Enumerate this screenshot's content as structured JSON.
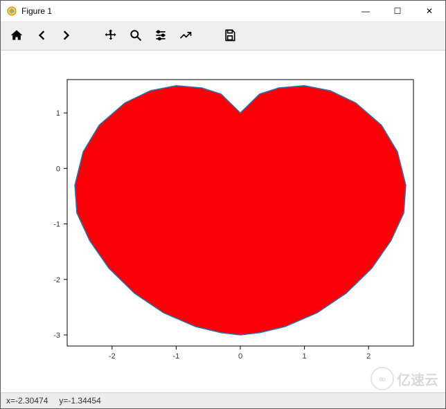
{
  "window": {
    "title": "Figure 1",
    "minimize": "—",
    "maximize": "☐",
    "close": "✕"
  },
  "toolbar": {
    "home": "home-icon",
    "back": "arrow-left-icon",
    "forward": "arrow-right-icon",
    "pan": "move-icon",
    "zoom": "zoom-icon",
    "subplots": "sliders-icon",
    "edit": "chart-edit-icon",
    "save": "save-icon"
  },
  "status": {
    "x_label": "x=-2.30474",
    "y_label": "y=-1.34454"
  },
  "watermark": {
    "logo": "∞",
    "text": "亿速云"
  },
  "chart_data": {
    "type": "area",
    "title": "",
    "xlabel": "",
    "ylabel": "",
    "xlim": [
      -2.7,
      2.7
    ],
    "ylim": [
      -3.2,
      1.6
    ],
    "xticks": [
      -2,
      -1,
      0,
      1,
      2
    ],
    "yticks": [
      -3,
      -2,
      -1,
      0,
      1
    ],
    "grid": false,
    "legend": false,
    "description": "Filled cardioid / heart-shaped curve centered near origin, symmetric about x=0, lobes peak near y≈1.5 at x≈±1. Cusp at (0,1). Bottom tip at (0,-3). Widest x extent ≈ ±2.6 near y≈-0.7.",
    "fill_color": "#fb0007",
    "edge_color": "#1f77b4",
    "curve_samples_xy": [
      [
        0.0,
        1.0
      ],
      [
        0.3,
        1.34
      ],
      [
        0.6,
        1.45
      ],
      [
        1.0,
        1.49
      ],
      [
        1.4,
        1.4
      ],
      [
        1.8,
        1.18
      ],
      [
        2.2,
        0.78
      ],
      [
        2.45,
        0.3
      ],
      [
        2.58,
        -0.3
      ],
      [
        2.55,
        -0.8
      ],
      [
        2.35,
        -1.3
      ],
      [
        2.05,
        -1.8
      ],
      [
        1.65,
        -2.25
      ],
      [
        1.2,
        -2.6
      ],
      [
        0.7,
        -2.85
      ],
      [
        0.3,
        -2.96
      ],
      [
        0.0,
        -3.0
      ],
      [
        -0.3,
        -2.96
      ],
      [
        -0.7,
        -2.85
      ],
      [
        -1.2,
        -2.6
      ],
      [
        -1.65,
        -2.25
      ],
      [
        -2.05,
        -1.8
      ],
      [
        -2.35,
        -1.3
      ],
      [
        -2.55,
        -0.8
      ],
      [
        -2.58,
        -0.3
      ],
      [
        -2.45,
        0.3
      ],
      [
        -2.2,
        0.78
      ],
      [
        -1.8,
        1.18
      ],
      [
        -1.4,
        1.4
      ],
      [
        -1.0,
        1.49
      ],
      [
        -0.6,
        1.45
      ],
      [
        -0.3,
        1.34
      ],
      [
        0.0,
        1.0
      ]
    ]
  }
}
